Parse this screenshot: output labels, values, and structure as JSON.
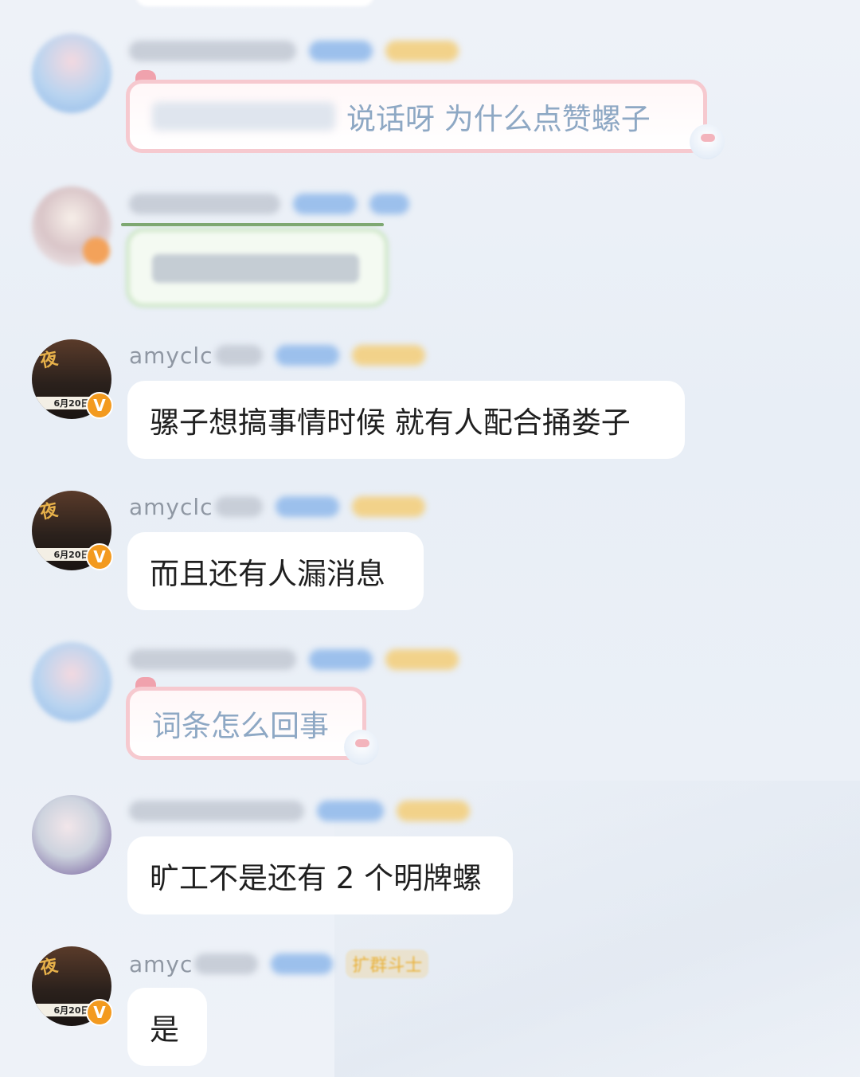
{
  "messages": [
    {
      "id": "msg1",
      "name_visible": "",
      "style": "pink-sticker",
      "text_blurred": "",
      "text": "说话呀  为什么点赞螺子"
    },
    {
      "id": "msg2",
      "name_visible": "",
      "style": "green-sticker",
      "text": ""
    },
    {
      "id": "msg3",
      "name_visible": "amyclc",
      "style": "plain",
      "text": "骡子想搞事情时候 就有人配合捅娄子",
      "avatar_date": "6月20日"
    },
    {
      "id": "msg4",
      "name_visible": "amyclc",
      "style": "plain",
      "text": "而且还有人漏消息",
      "avatar_date": "6月20日"
    },
    {
      "id": "msg5",
      "name_visible": "",
      "style": "pink-sticker",
      "text": "词条怎么回事"
    },
    {
      "id": "msg6",
      "name_visible": "",
      "style": "plain",
      "text": "旷工不是还有 2 个明牌螺"
    },
    {
      "id": "msg7",
      "name_visible": "amyc",
      "badge_text": "扩群斗士",
      "style": "plain",
      "text": "是",
      "avatar_date": "6月20日"
    }
  ],
  "verified_mark": "V",
  "colors": {
    "bubble": "#ffffff",
    "verified": "#f39a1f",
    "badge_blue": "#9cc0ec",
    "badge_gold": "#f2d28a",
    "pink_border": "#f6c9cf",
    "green_border": "#cfe7c8"
  }
}
